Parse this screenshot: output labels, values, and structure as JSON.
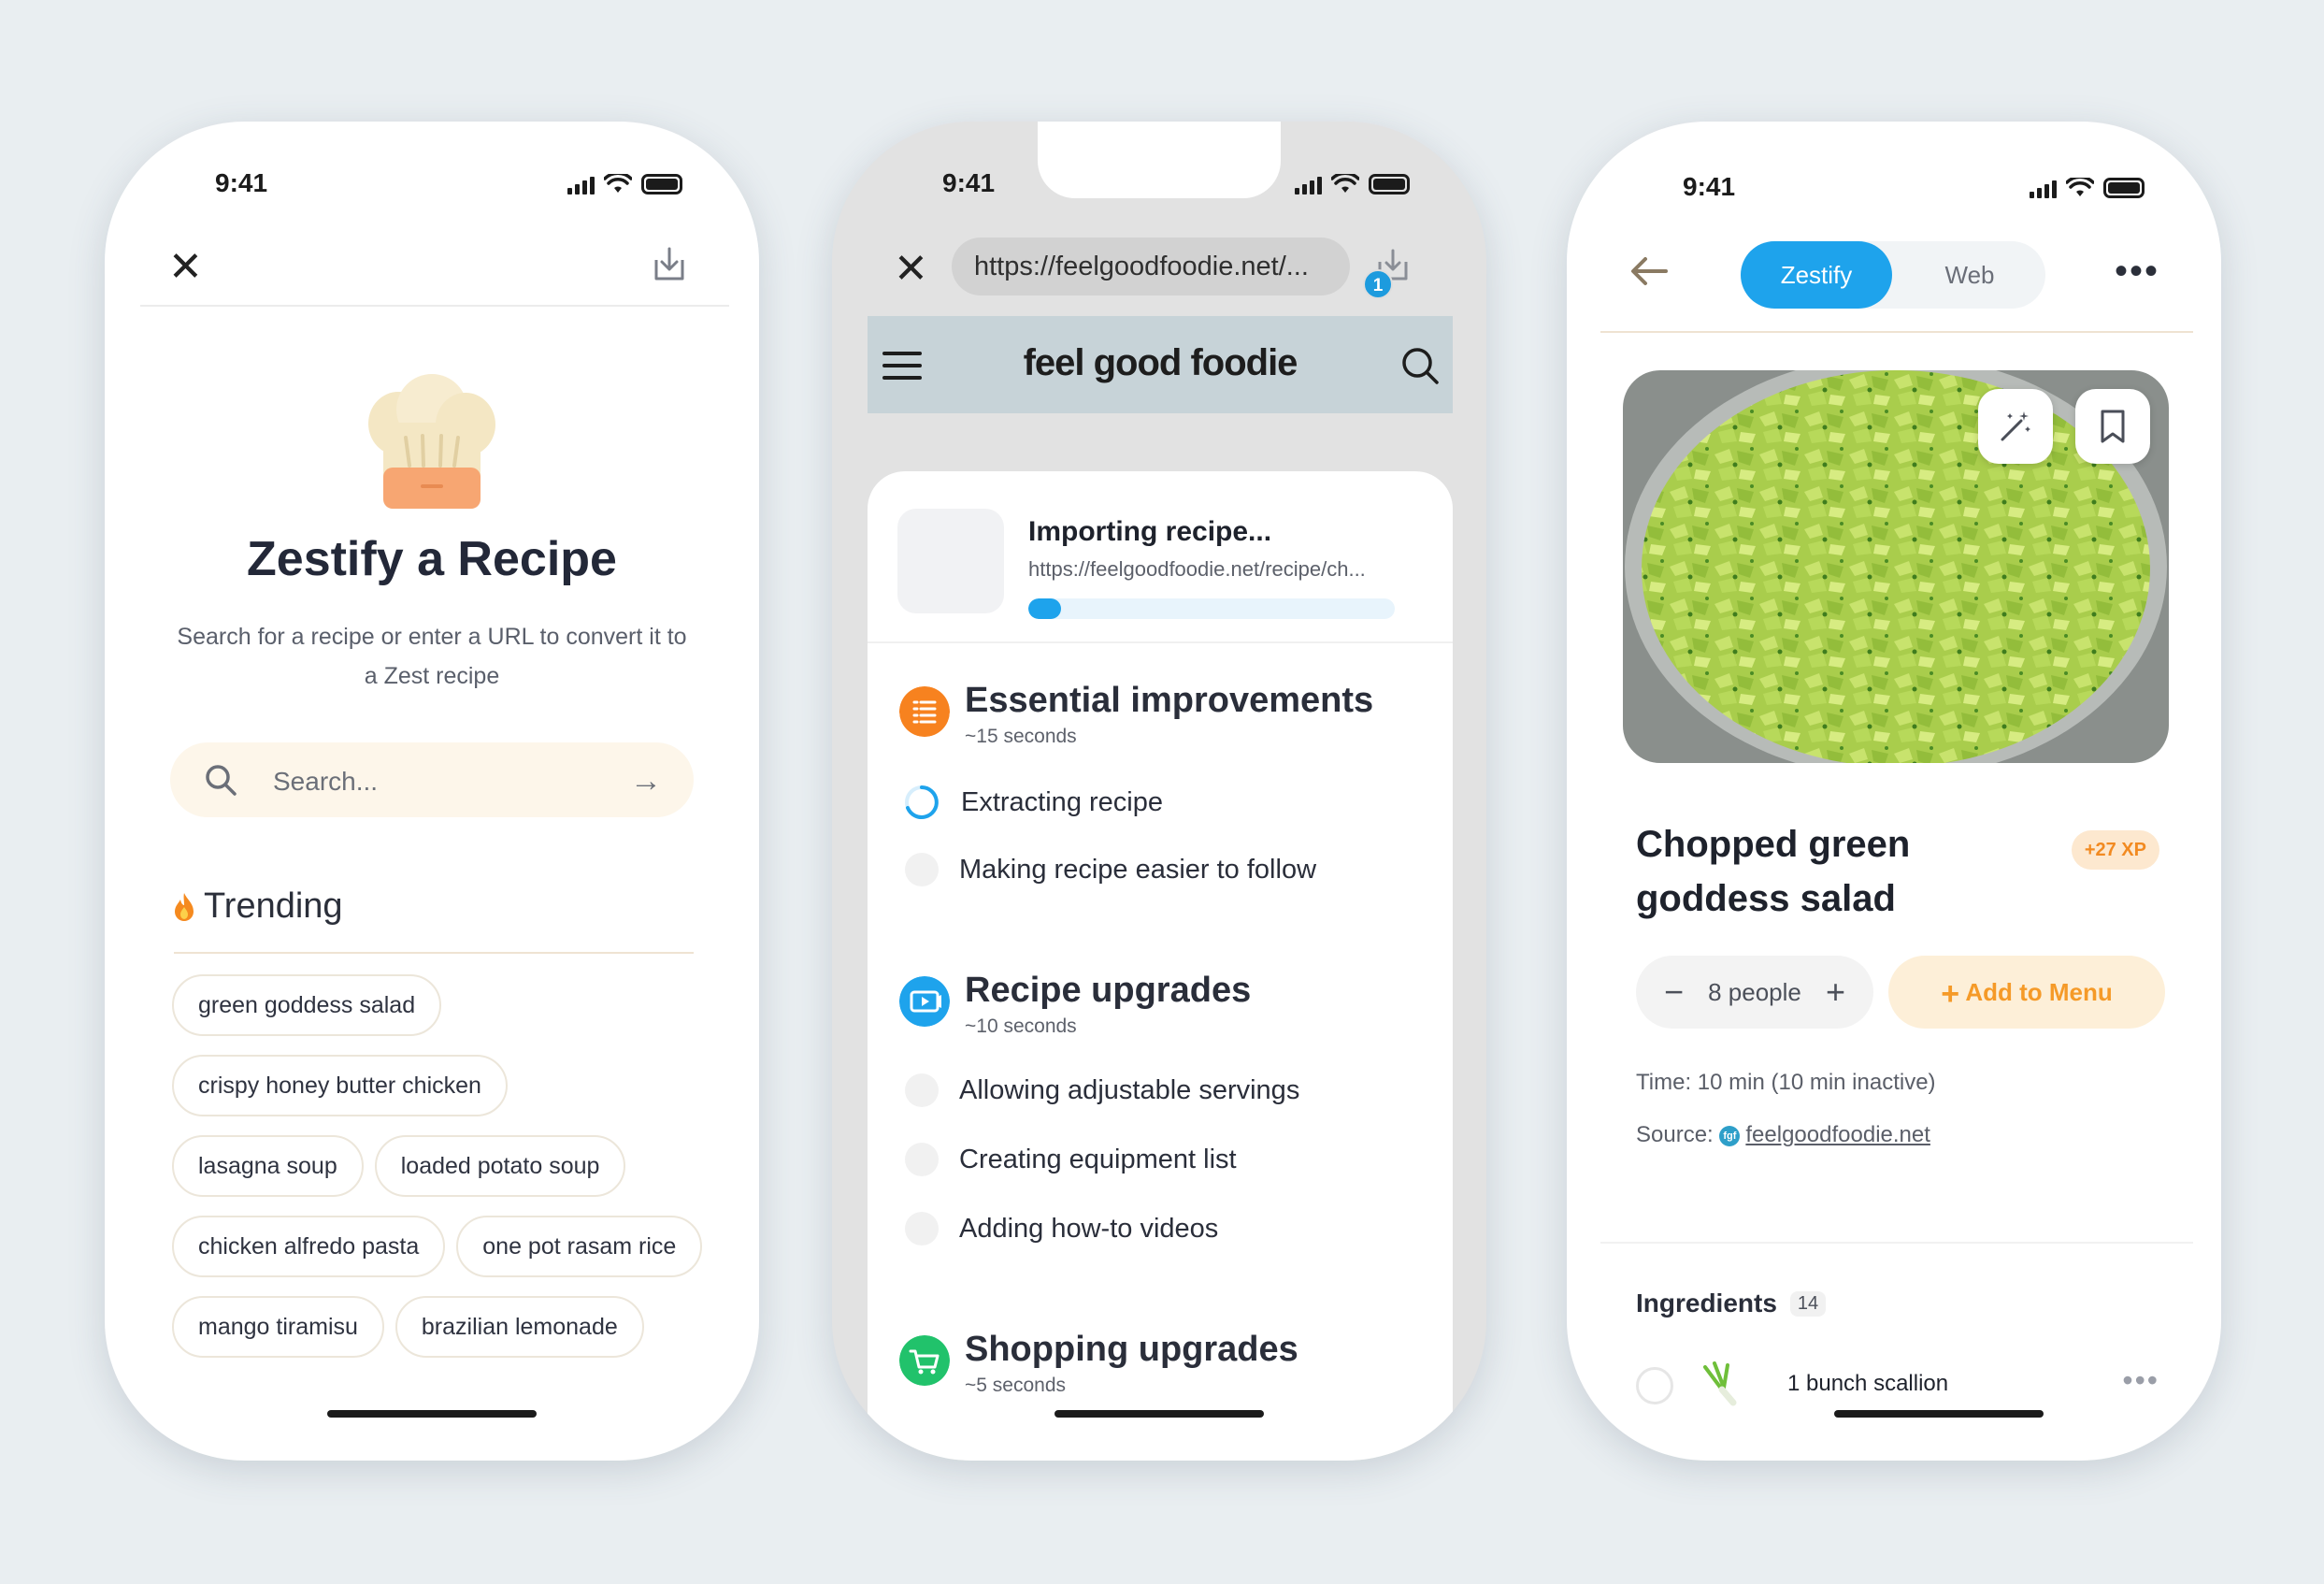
{
  "status_time": "9:41",
  "screen1": {
    "title": "Zestify a Recipe",
    "subtitle": "Search for a recipe or enter a URL to convert it to a Zest recipe",
    "search_placeholder": "Search...",
    "trending_label": "Trending",
    "trending_items": [
      "green goddess salad",
      "crispy honey butter chicken",
      "lasagna soup",
      "loaded potato soup",
      "chicken alfredo pasta",
      "one pot rasam rice",
      "mango tiramisu",
      "brazilian lemonade"
    ]
  },
  "screen2": {
    "url": "https://feelgoodfoodie.net/...",
    "download_badge": "1",
    "site_logo": "feel good foodie",
    "importing_title": "Importing recipe...",
    "importing_url": "https://feelgoodfoodie.net/recipe/ch...",
    "progress": 0.09,
    "sections": [
      {
        "title": "Essential improvements",
        "time": "~15 seconds",
        "color": "#f7821f",
        "steps": [
          "Extracting recipe",
          "Making recipe easier to follow"
        ]
      },
      {
        "title": "Recipe upgrades",
        "time": "~10 seconds",
        "color": "#1ea3ec",
        "steps": [
          "Allowing adjustable servings",
          "Creating equipment list",
          "Adding how-to videos"
        ]
      },
      {
        "title": "Shopping upgrades",
        "time": "~5 seconds",
        "color": "#21c26b",
        "steps": []
      }
    ]
  },
  "screen3": {
    "tab_active": "Zestify",
    "tab_inactive": "Web",
    "recipe_title": "Chopped green goddess salad",
    "xp_badge": "+27 XP",
    "servings": "8 people",
    "add_to_menu": "Add to Menu",
    "time_label": "Time: 10 min (10 min inactive)",
    "source_label": "Source:",
    "source_icon_text": "fgf",
    "source_link": "feelgoodfoodie.net",
    "ingredients_label": "Ingredients",
    "ingredients_count": "14",
    "first_ingredient": "1 bunch scallion"
  },
  "colors": {
    "accent_blue": "#1ea3ec",
    "accent_orange": "#f59a28",
    "background": "#e9eef1"
  }
}
